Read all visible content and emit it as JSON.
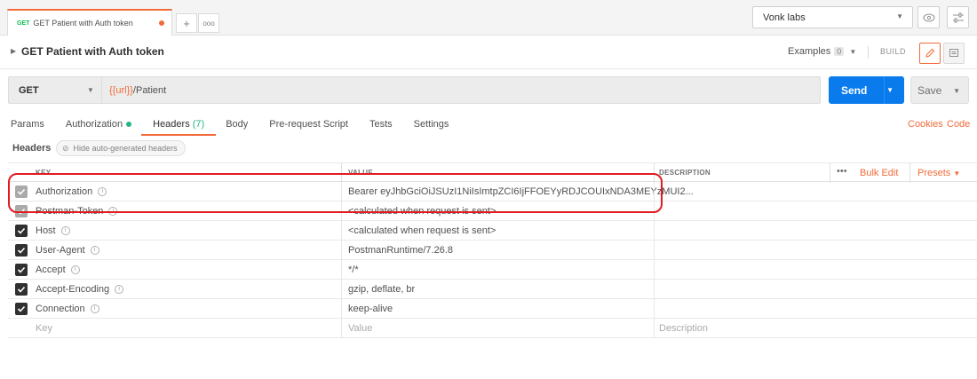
{
  "tab": {
    "method": "GET",
    "name": "GET Patient with Auth token",
    "new_tab": "+",
    "more": "ooo"
  },
  "environment": {
    "selected": "Vonk labs"
  },
  "request": {
    "title": "GET Patient with Auth token",
    "examples_label": "Examples",
    "examples_count": "0",
    "build_label": "BUILD",
    "method": "GET",
    "url_var": "{{url}}",
    "url_path": "/Patient",
    "send_label": "Send",
    "save_label": "Save"
  },
  "tabs": {
    "params": "Params",
    "authorization": "Authorization",
    "headers": "Headers",
    "headers_count": "(7)",
    "body": "Body",
    "prerequest": "Pre-request Script",
    "tests": "Tests",
    "settings": "Settings",
    "cookies": "Cookies",
    "code": "Code"
  },
  "headers_section": {
    "label": "Headers",
    "hide_label": "Hide auto-generated headers"
  },
  "table": {
    "col_key": "KEY",
    "col_value": "VALUE",
    "col_description": "DESCRIPTION",
    "more": "•••",
    "bulk_edit": "Bulk Edit",
    "presets": "Presets",
    "rows": [
      {
        "key": "Authorization",
        "value": "Bearer eyJhbGciOiJSUzI1NiIsImtpZCI6IjFFOEYyRDJCOUIxNDA3MEYzMUI2..."
      },
      {
        "key": "Postman-Token",
        "value": "<calculated when request is sent>"
      },
      {
        "key": "Host",
        "value": "<calculated when request is sent>"
      },
      {
        "key": "User-Agent",
        "value": "PostmanRuntime/7.26.8"
      },
      {
        "key": "Accept",
        "value": "*/*"
      },
      {
        "key": "Accept-Encoding",
        "value": "gzip, deflate, br"
      },
      {
        "key": "Connection",
        "value": "keep-alive"
      }
    ],
    "placeholder": {
      "key": "Key",
      "value": "Value",
      "description": "Description"
    }
  },
  "colors": {
    "accent": "#f26b3a",
    "send": "#097bed",
    "active_count": "#26b47f",
    "highlight": "#e01b22"
  }
}
